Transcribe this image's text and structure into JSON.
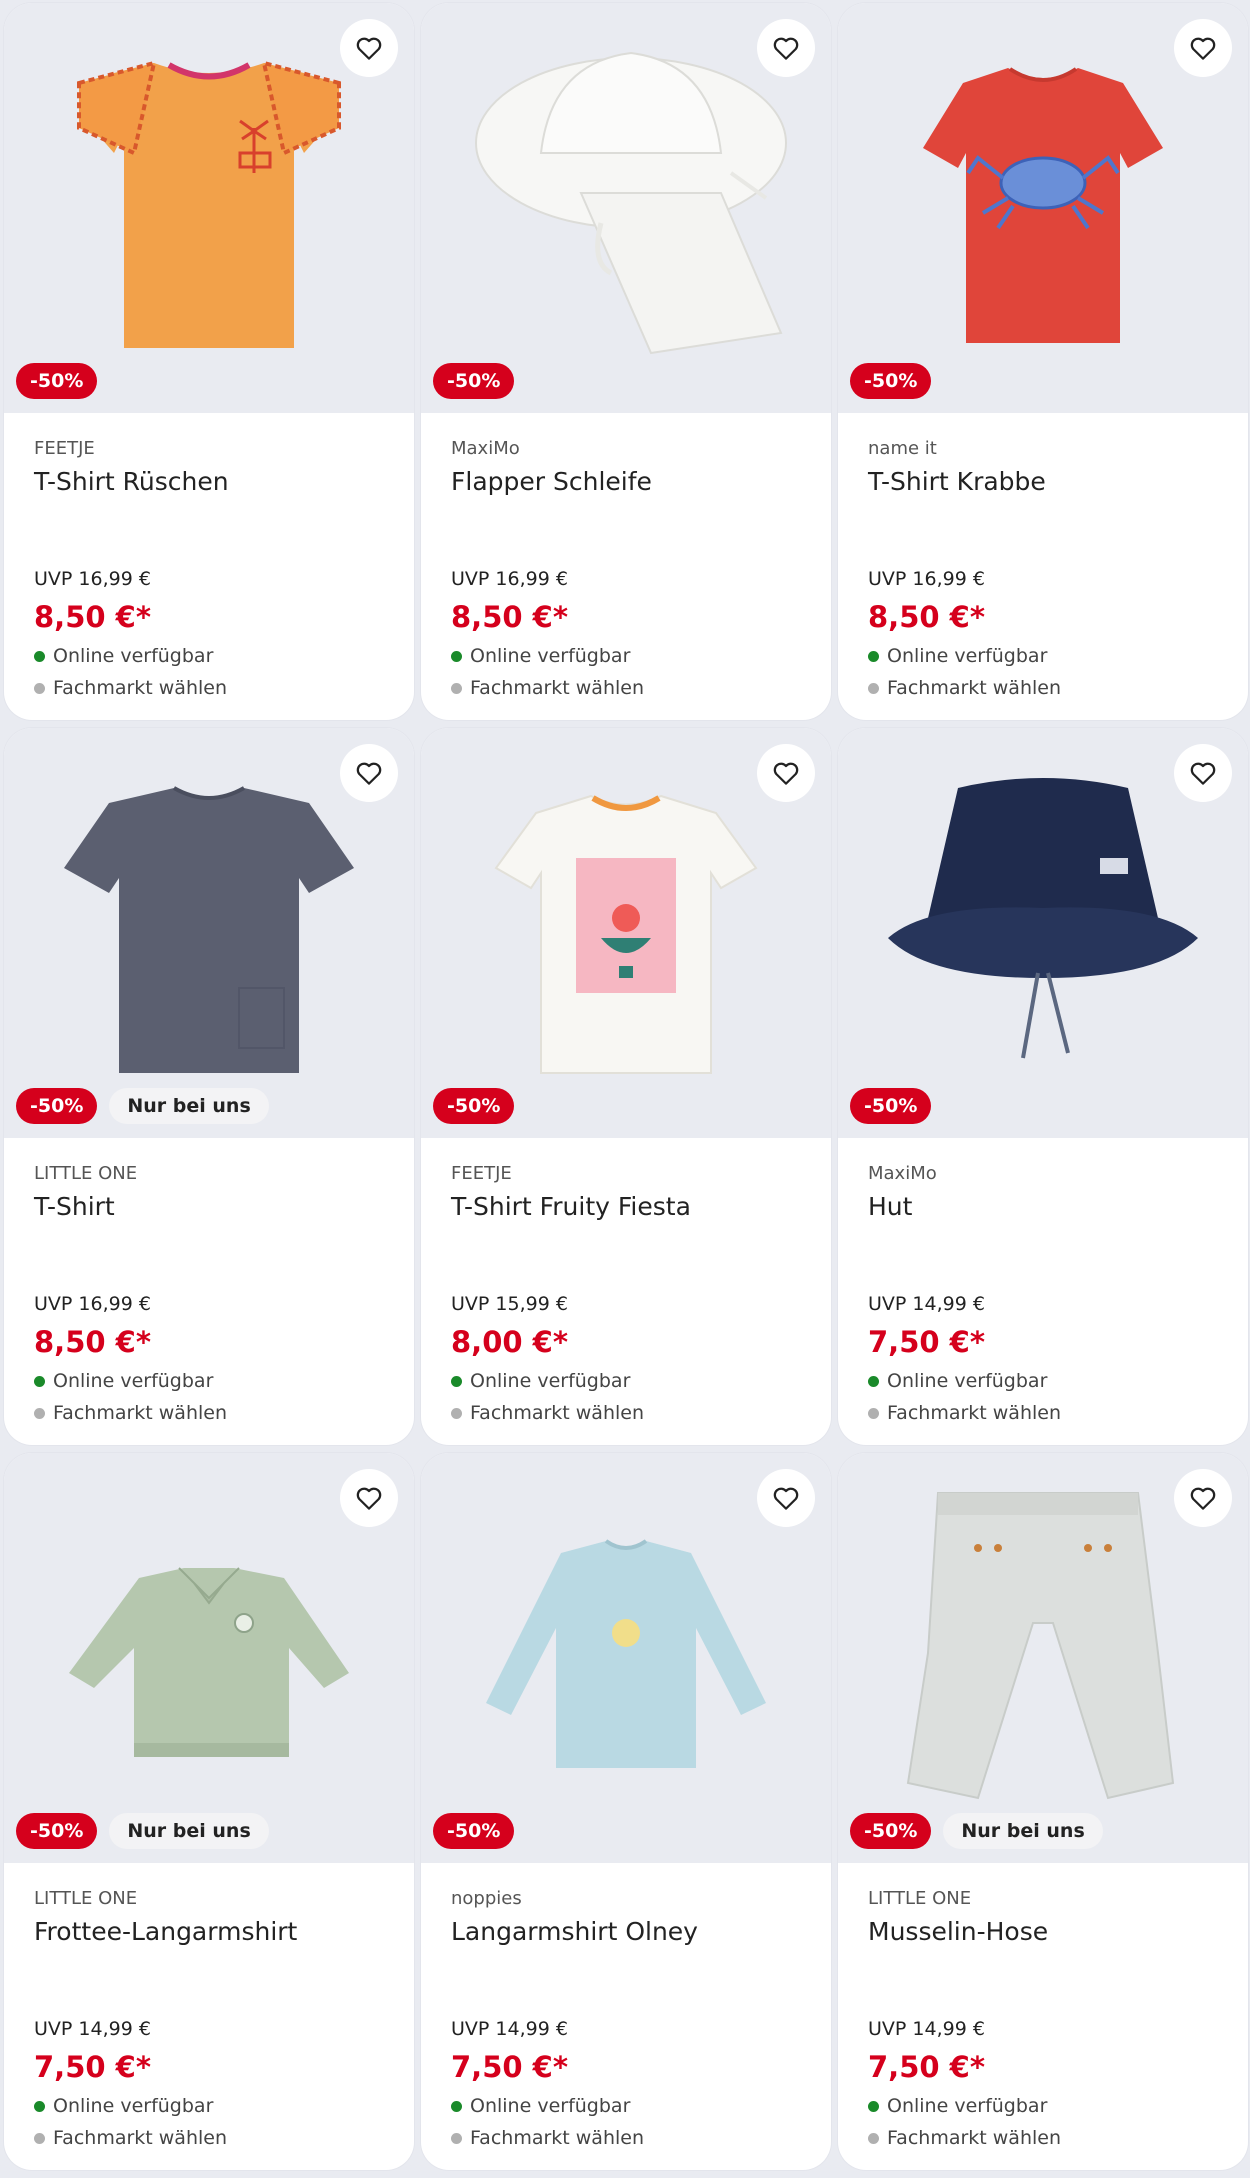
{
  "colors": {
    "sale": "#d5001c",
    "online_dot": "#1a8a2a",
    "store_dot": "#b0b0b0",
    "card_bg": "#ffffff",
    "image_bg": "#e9ebf1"
  },
  "products": [
    {
      "brand": "FEETJE",
      "title": "T-Shirt Rüschen",
      "uvp": "UVP 16,99 €",
      "price": "8,50 €*",
      "discount": "-50%",
      "exclusive": "",
      "online": "Online verfügbar",
      "store": "Fachmarkt wählen",
      "icon": "orange-ruffle-tshirt"
    },
    {
      "brand": "MaxiMo",
      "title": "Flapper Schleife",
      "uvp": "UVP 16,99 €",
      "price": "8,50 €*",
      "discount": "-50%",
      "exclusive": "",
      "online": "Online verfügbar",
      "store": "Fachmarkt wählen",
      "icon": "white-sun-hat"
    },
    {
      "brand": "name it",
      "title": "T-Shirt Krabbe",
      "uvp": "UVP 16,99 €",
      "price": "8,50 €*",
      "discount": "-50%",
      "exclusive": "",
      "online": "Online verfügbar",
      "store": "Fachmarkt wählen",
      "icon": "red-crab-tshirt"
    },
    {
      "brand": "LITTLE ONE",
      "title": "T-Shirt",
      "uvp": "UVP 16,99 €",
      "price": "8,50 €*",
      "discount": "-50%",
      "exclusive": "Nur bei uns",
      "online": "Online verfügbar",
      "store": "Fachmarkt wählen",
      "icon": "grey-tshirt"
    },
    {
      "brand": "FEETJE",
      "title": "T-Shirt Fruity Fiesta",
      "uvp": "UVP 15,99 €",
      "price": "8,00 €*",
      "discount": "-50%",
      "exclusive": "",
      "online": "Online verfügbar",
      "store": "Fachmarkt wählen",
      "icon": "white-print-tshirt"
    },
    {
      "brand": "MaxiMo",
      "title": "Hut",
      "uvp": "UVP 14,99 €",
      "price": "7,50 €*",
      "discount": "-50%",
      "exclusive": "",
      "online": "Online verfügbar",
      "store": "Fachmarkt wählen",
      "icon": "navy-bucket-hat"
    },
    {
      "brand": "LITTLE ONE",
      "title": "Frottee-Langarmshirt",
      "uvp": "UVP 14,99 €",
      "price": "7,50 €*",
      "discount": "-50%",
      "exclusive": "Nur bei uns",
      "online": "Online verfügbar",
      "store": "Fachmarkt wählen",
      "icon": "green-sweatshirt"
    },
    {
      "brand": "noppies",
      "title": "Langarmshirt Olney",
      "uvp": "UVP 14,99 €",
      "price": "7,50 €*",
      "discount": "-50%",
      "exclusive": "",
      "online": "Online verfügbar",
      "store": "Fachmarkt wählen",
      "icon": "light-blue-longsleeve"
    },
    {
      "brand": "LITTLE ONE",
      "title": "Musselin-Hose",
      "uvp": "UVP 14,99 €",
      "price": "7,50 €*",
      "discount": "-50%",
      "exclusive": "Nur bei uns",
      "online": "Online verfügbar",
      "store": "Fachmarkt wählen",
      "icon": "grey-muslin-pants"
    }
  ]
}
